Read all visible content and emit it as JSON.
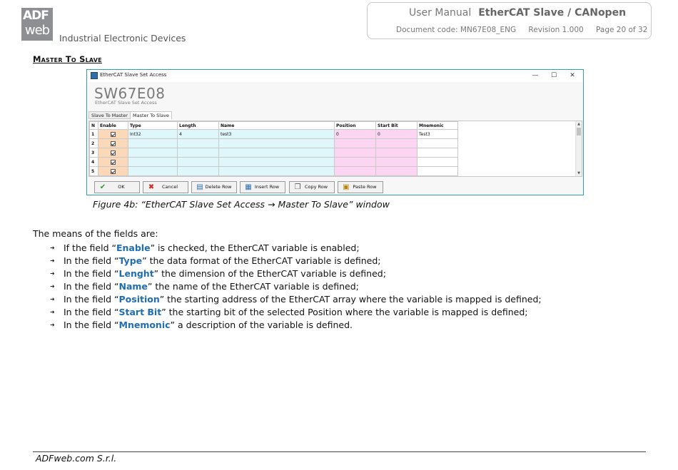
{
  "header": {
    "logo_line1": "ADF",
    "logo_line2": "web",
    "tagline": "Industrial Electronic Devices",
    "doc_type": "User Manual",
    "product": "EtherCAT Slave / CANopen",
    "doc_code": "Document code: MN67E08_ENG",
    "revision": "Revision 1.000",
    "page": "Page 20 of 32"
  },
  "section_title": "Master To Slave",
  "dialog": {
    "window_title": "EtherCAT Slave Set Access",
    "minimize": "—",
    "maximize": "☐",
    "close": "✕",
    "device_name": "SW67E08",
    "device_sub": "EtherCAT Slave Set Access",
    "tabs": [
      {
        "label": "Slave To Master",
        "active": false
      },
      {
        "label": "Master To Slave",
        "active": true
      }
    ],
    "columns": [
      "N",
      "Enable",
      "Type",
      "Length",
      "Name",
      "Position",
      "Start Bit",
      "Mnemonic"
    ],
    "rows": [
      {
        "n": "1",
        "enabled": true,
        "type": "Int32",
        "length": "4",
        "name": "test3",
        "position": "0",
        "start_bit": "0",
        "mnemonic": "Test3"
      },
      {
        "n": "2",
        "enabled": true,
        "type": "",
        "length": "",
        "name": "",
        "position": "",
        "start_bit": "",
        "mnemonic": ""
      },
      {
        "n": "3",
        "enabled": true,
        "type": "",
        "length": "",
        "name": "",
        "position": "",
        "start_bit": "",
        "mnemonic": ""
      },
      {
        "n": "4",
        "enabled": true,
        "type": "",
        "length": "",
        "name": "",
        "position": "",
        "start_bit": "",
        "mnemonic": ""
      },
      {
        "n": "5",
        "enabled": true,
        "type": "",
        "length": "",
        "name": "",
        "position": "",
        "start_bit": "",
        "mnemonic": ""
      }
    ],
    "buttons": {
      "ok": "OK",
      "cancel": "Cancel",
      "delete_row": "Delete Row",
      "insert_row": "Insert Row",
      "copy_row": "Copy Row",
      "paste_row": "Paste Row"
    },
    "colors": {
      "enable_col": "#fbd8b8",
      "data_col": "#dff6fb",
      "position_col": "#fbd5f1",
      "border": "#2aa4a8"
    }
  },
  "caption": "Figure 4b: “EtherCAT Slave Set Access → Master To Slave” window",
  "lead": "The means of the fields are:",
  "bullets": [
    {
      "pre": "If the field “",
      "kw": "Enable",
      "post": "” is checked, the EtherCAT variable is enabled;"
    },
    {
      "pre": "In the field “",
      "kw": "Type",
      "post": "” the data format of the EtherCAT variable is defined;"
    },
    {
      "pre": "In the field “",
      "kw": "Lenght",
      "post": "” the dimension of the EtherCAT variable is defined;"
    },
    {
      "pre": "In the field “",
      "kw": "Name",
      "post": "” the name of the EtherCAT variable is defined;"
    },
    {
      "pre": "In the field “",
      "kw": "Position",
      "post": "” the starting address of the EtherCAT array where the variable is mapped is defined;"
    },
    {
      "pre": "In the field “",
      "kw": "Start Bit",
      "post": "” the starting bit of the selected Position where the variable is mapped is defined;"
    },
    {
      "pre": "In the field “",
      "kw": "Mnemonic",
      "post": "” a description of the variable is defined."
    }
  ],
  "footer": "ADFweb.com S.r.l."
}
